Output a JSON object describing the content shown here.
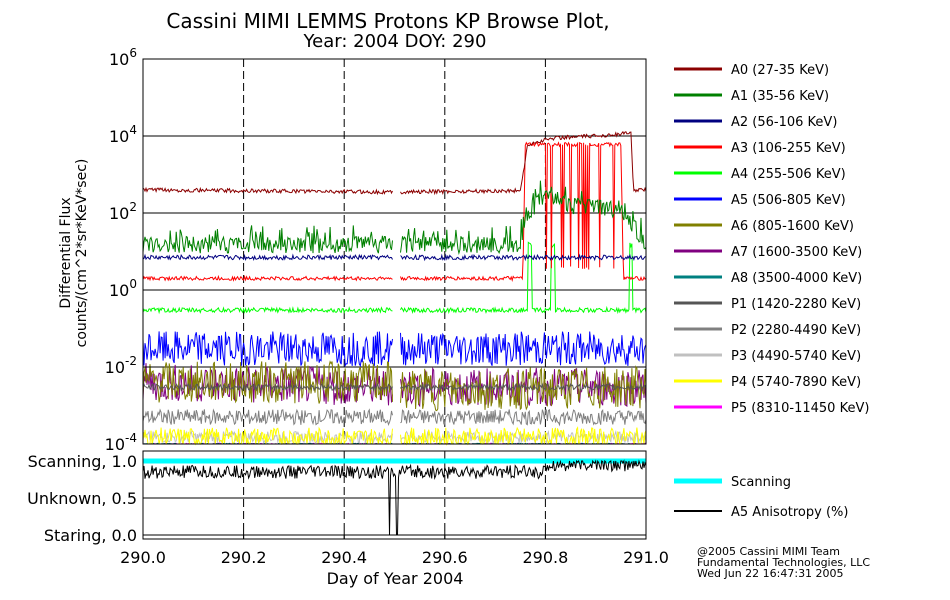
{
  "chart_data": {
    "type": "line",
    "title": "Cassini MIMI LEMMS Protons KP Browse Plot,",
    "subtitle": "Year: 2004 DOY: 290",
    "xlabel": "Day of Year 2004",
    "ylabel_top": "Differential Flux",
    "ylabel_bottom": "counts/(cm^2*sr*KeV*sec)",
    "xlim": [
      290.0,
      291.0
    ],
    "x_ticks": [
      "290.0",
      "290.2",
      "290.4",
      "290.6",
      "290.8",
      "291.0"
    ],
    "top_panel": {
      "scale": "log",
      "ylim": [
        0.0001,
        1000000
      ],
      "y_ticks": [
        {
          "base": "10",
          "exp": "6",
          "value": 1000000
        },
        {
          "base": "10",
          "exp": "4",
          "value": 10000
        },
        {
          "base": "10",
          "exp": "2",
          "value": 100
        },
        {
          "base": "10",
          "exp": "0",
          "value": 1
        },
        {
          "base": "10",
          "exp": "-2",
          "value": 0.01
        },
        {
          "base": "10",
          "exp": "-4",
          "value": 0.0001
        }
      ],
      "data_gap": [
        290.496,
        290.512
      ],
      "series": [
        {
          "name": "A0 (27-35 KeV)",
          "color": "#8b0000",
          "level": 400,
          "profile": [
            [
              290.0,
              400
            ],
            [
              290.5,
              350
            ],
            [
              290.75,
              380
            ],
            [
              290.765,
              6000
            ],
            [
              290.8,
              8000
            ],
            [
              290.82,
              9000
            ],
            [
              290.9,
              10000
            ],
            [
              290.97,
              12000
            ],
            [
              290.975,
              400
            ],
            [
              291.0,
              400
            ]
          ]
        },
        {
          "name": "A1 (35-56 KeV)",
          "color": "#008000",
          "level": 15,
          "profile": [
            [
              290.0,
              15
            ],
            [
              290.75,
              15
            ],
            [
              290.76,
              80
            ],
            [
              290.8,
              300
            ],
            [
              290.85,
              150
            ],
            [
              290.95,
              120
            ],
            [
              291.0,
              15
            ]
          ]
        },
        {
          "name": "A2 (56-106 KeV)",
          "color": "#000080",
          "level": 7,
          "profile": [
            [
              290.0,
              7
            ],
            [
              291.0,
              7
            ]
          ]
        },
        {
          "name": "A3 (106-255 KeV)",
          "color": "#ff0000",
          "level": 2,
          "profile": [
            [
              290.0,
              2
            ],
            [
              290.755,
              2
            ],
            [
              290.76,
              6000
            ],
            [
              290.95,
              6000
            ],
            [
              290.955,
              2
            ],
            [
              291.0,
              2
            ]
          ]
        },
        {
          "name": "A4 (255-506 KeV)",
          "color": "#00ff00",
          "level": 0.3,
          "profile": [
            [
              290.0,
              0.3
            ],
            [
              291.0,
              0.3
            ]
          ]
        },
        {
          "name": "A5 (506-805 KeV)",
          "color": "#0000ff",
          "level": 0.03,
          "profile": [
            [
              290.0,
              0.03
            ],
            [
              291.0,
              0.03
            ]
          ]
        },
        {
          "name": "A6 (805-1600 KeV)",
          "color": "#808000",
          "level": 0.004,
          "profile": [
            [
              290.0,
              0.004
            ],
            [
              290.5,
              0.004
            ],
            [
              290.51,
              0.0025
            ],
            [
              291.0,
              0.003
            ]
          ]
        },
        {
          "name": "A7 (1600-3500 KeV)",
          "color": "#800080",
          "level": 0.004,
          "profile": [
            [
              290.0,
              0.004
            ],
            [
              290.5,
              0.003
            ],
            [
              291.0,
              0.003
            ]
          ]
        },
        {
          "name": "A8 (3500-4000 KeV)",
          "color": "#008080",
          "level": 0.0001,
          "profile": [
            [
              290.0,
              0.0001
            ],
            [
              291.0,
              0.0001
            ]
          ]
        },
        {
          "name": "P1 (1420-2280 KeV)",
          "color": "#555555",
          "level": 0.003,
          "profile": [
            [
              290.0,
              0.003
            ],
            [
              291.0,
              0.003
            ]
          ]
        },
        {
          "name": "P2 (2280-4490 KeV)",
          "color": "#808080",
          "level": 0.0005,
          "profile": [
            [
              290.0,
              0.0005
            ],
            [
              291.0,
              0.0005
            ]
          ]
        },
        {
          "name": "P3 (4490-5740 KeV)",
          "color": "#c0c0c0",
          "level": 0.00015,
          "profile": [
            [
              290.0,
              0.00015
            ],
            [
              291.0,
              0.00015
            ]
          ]
        },
        {
          "name": "P4 (5740-7890 KeV)",
          "color": "#ffff00",
          "level": 0.00015,
          "profile": [
            [
              290.0,
              0.00015
            ],
            [
              291.0,
              0.00015
            ]
          ]
        },
        {
          "name": "P5 (8310-11450 KeV)",
          "color": "#ff00ff",
          "level": 0.0001,
          "profile": [
            [
              290.0,
              0.0001
            ],
            [
              291.0,
              0.0001
            ]
          ]
        }
      ]
    },
    "bottom_panel": {
      "ylim": [
        0.0,
        1.0
      ],
      "y_ticks": [
        {
          "label": "Scanning, 1.0",
          "value": 1.0
        },
        {
          "label": "Unknown, 0.5",
          "value": 0.5
        },
        {
          "label": "Staring, 0.0",
          "value": 0.0
        }
      ],
      "series": [
        {
          "name": "Scanning",
          "color": "#00ffff",
          "value": 1.0
        },
        {
          "name": "A5 Anisotropy (%)",
          "color": "#000000",
          "level": 0.85,
          "dips": [
            [
              290.49,
              0.0
            ],
            [
              290.505,
              0.0
            ]
          ]
        }
      ]
    },
    "grid": true
  },
  "footer": {
    "line1": "@2005 Cassini MIMI Team",
    "line2": "Fundamental Technologies, LLC",
    "line3": "Wed Jun 22 16:47:31 2005"
  }
}
